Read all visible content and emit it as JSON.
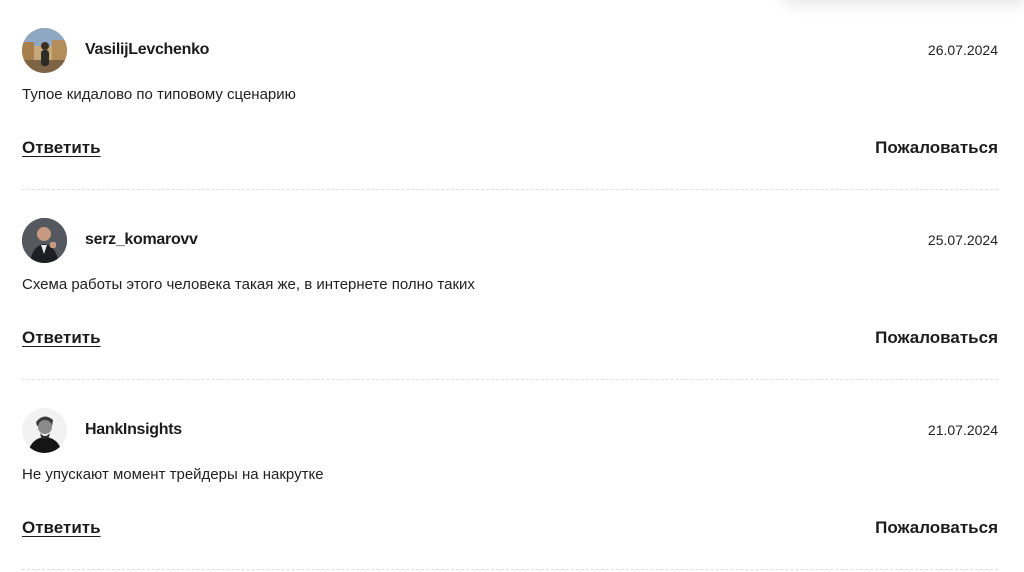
{
  "comments": [
    {
      "username": "VasilijLevchenko",
      "date": "26.07.2024",
      "text": "Тупое кидалово по типовому сценарию",
      "reply_label": "Ответить",
      "report_label": "Пожаловаться",
      "avatar_icon": "user-photo-street"
    },
    {
      "username": "serz_komarovv",
      "date": "25.07.2024",
      "text": "Схема работы этого человека такая же, в интернете полно таких",
      "reply_label": "Ответить",
      "report_label": "Пожаловаться",
      "avatar_icon": "user-photo-suit"
    },
    {
      "username": "HankInsights",
      "date": "21.07.2024",
      "text": "Не упускают момент трейдеры на накрутке",
      "reply_label": "Ответить",
      "report_label": "Пожаловаться",
      "avatar_icon": "user-photo-bw"
    }
  ]
}
